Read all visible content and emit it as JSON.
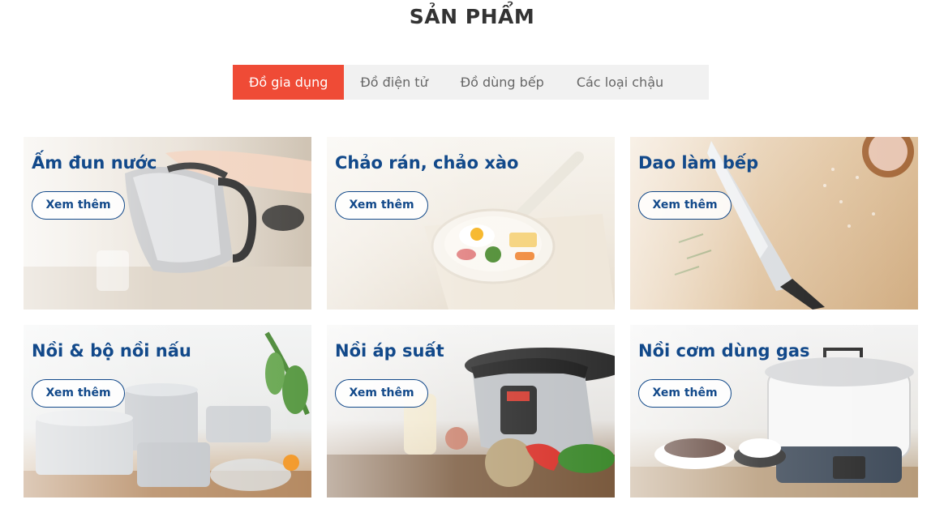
{
  "section": {
    "title": "SẢN PHẨM"
  },
  "tabs": [
    {
      "label": "Đồ gia dụng",
      "active": true
    },
    {
      "label": "Đồ điện tử",
      "active": false
    },
    {
      "label": "Đồ dùng bếp",
      "active": false
    },
    {
      "label": "Các loại chậu",
      "active": false
    }
  ],
  "colors": {
    "accent": "#ef4b36",
    "title_blue": "#12498a",
    "tab_bg": "#f1f1f1"
  },
  "products": [
    {
      "title": "Ấm đun nước",
      "button": "Xem thêm",
      "image": "electric-kettle-pouring"
    },
    {
      "title": "Chảo rán, chảo xào",
      "button": "Xem thêm",
      "image": "frying-pan-with-egg"
    },
    {
      "title": "Dao làm bếp",
      "button": "Xem thêm",
      "image": "chef-knife-on-board"
    },
    {
      "title": "Nồi & bộ nồi nấu",
      "button": "Xem thêm",
      "image": "stainless-pot-set"
    },
    {
      "title": "Nồi áp suất",
      "button": "Xem thêm",
      "image": "pressure-cooker"
    },
    {
      "title": "Nồi cơm dùng gas",
      "button": "Xem thêm",
      "image": "gas-rice-cooker"
    }
  ]
}
